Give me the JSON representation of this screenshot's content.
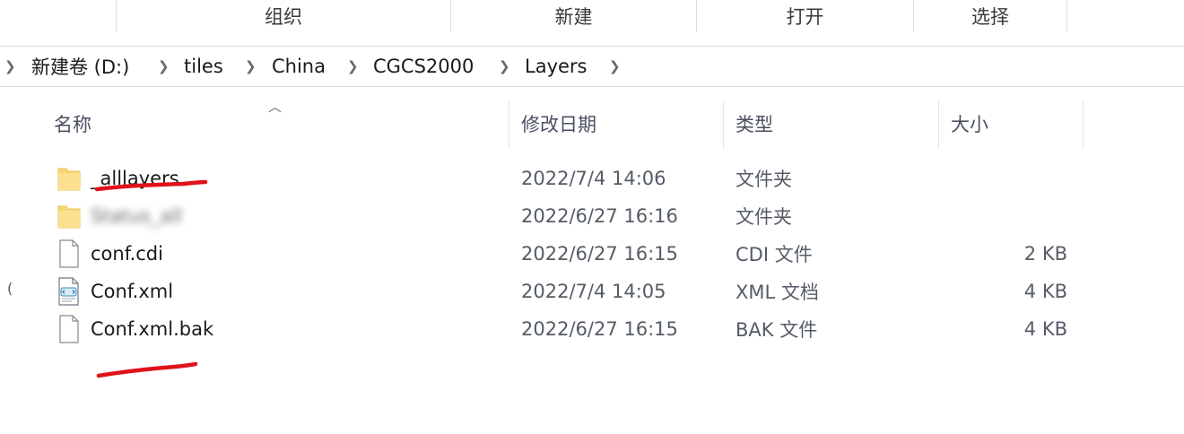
{
  "ribbon": {
    "groups": [
      "组织",
      "新建",
      "打开",
      "选择"
    ]
  },
  "address": {
    "crumbs": [
      "新建卷 (D:)",
      "tiles",
      "China",
      "CGCS2000",
      "Layers"
    ]
  },
  "columns": {
    "name": "名称",
    "date": "修改日期",
    "type": "类型",
    "size": "大小"
  },
  "files": [
    {
      "name": "_alllayers",
      "date": "2022/7/4 14:06",
      "type": "文件夹",
      "size": "",
      "icon": "folder-icon"
    },
    {
      "name": "Status_all",
      "date": "2022/6/27 16:16",
      "type": "文件夹",
      "size": "",
      "icon": "folder-icon"
    },
    {
      "name": "conf.cdi",
      "date": "2022/6/27 16:15",
      "type": "CDI 文件",
      "size": "2 KB",
      "icon": "file-icon"
    },
    {
      "name": "Conf.xml",
      "date": "2022/7/4 14:05",
      "type": "XML 文档",
      "size": "4 KB",
      "icon": "xml-file-icon"
    },
    {
      "name": "Conf.xml.bak",
      "date": "2022/6/27 16:15",
      "type": "BAK 文件",
      "size": "4 KB",
      "icon": "file-icon"
    }
  ],
  "colors": {
    "annotation": "#e0121a",
    "folder": "#f8d775",
    "folder_dark": "#e9c25a"
  }
}
